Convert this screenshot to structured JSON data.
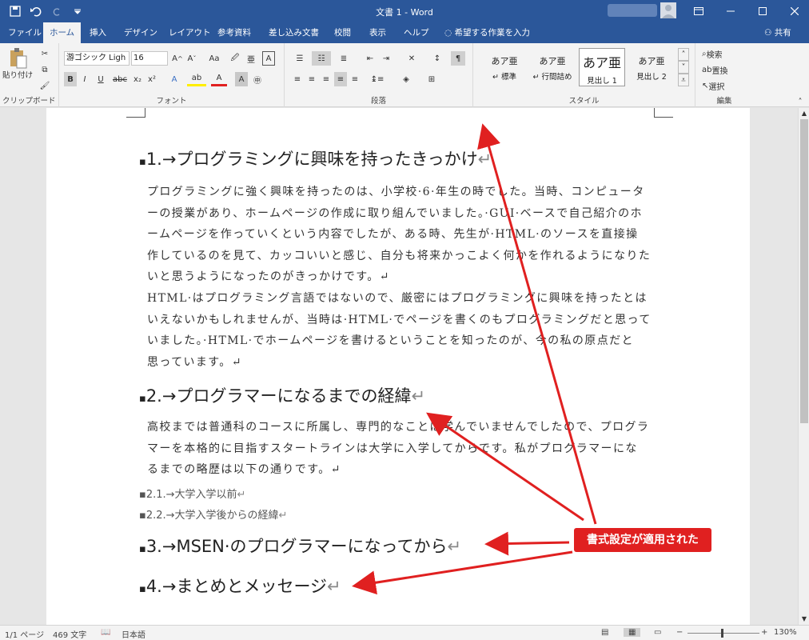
{
  "window": {
    "title": "文書 1 - Word",
    "share": "共有"
  },
  "tabs": [
    "ファイル",
    "ホーム",
    "挿入",
    "デザイン",
    "レイアウト",
    "参考資料",
    "差し込み文書",
    "校閲",
    "表示",
    "ヘルプ",
    "希望する作業を入力"
  ],
  "ribbon": {
    "clipboard": {
      "paste": "貼り付け",
      "label": "クリップボード"
    },
    "font": {
      "name": "游ゴシック Ligh",
      "size": "16",
      "label": "フォント",
      "case": "Aa"
    },
    "paragraph": {
      "label": "段落"
    },
    "styles": {
      "label": "スタイル",
      "items": [
        {
          "sample": "あア亜",
          "name": "↵ 標準"
        },
        {
          "sample": "あア亜",
          "name": "↵ 行間詰め"
        },
        {
          "sample": "あア亜",
          "name": "見出し 1"
        },
        {
          "sample": "あア亜",
          "name": "見出し 2"
        }
      ]
    },
    "editing": {
      "search": "検索",
      "replace": "置換",
      "select": "選択",
      "label": "編集"
    }
  },
  "document": {
    "heading1": "1.→プログラミングに興味を持ったきっかけ",
    "para1": [
      "プログラミングに強く興味を持ったのは、小学校·6·年生の時でした。当時、コンピュータ",
      "ーの授業があり、ホームページの作成に取り組んでいました。·GUI·ベースで自己紹介のホ",
      "ームページを作っていくという内容でしたが、ある時、先生が·HTML·のソースを直接操",
      "作しているのを見て、カッコいいと感じ、自分も将来かっこよく何かを作れるようになりた",
      "いと思うようになったのがきっかけです。↵"
    ],
    "para2": [
      "HTML·はプログラミング言語ではないので、厳密にはプログラミングに興味を持ったとは",
      "いえないかもしれませんが、当時は·HTML·でページを書くのもプログラミングだと思って",
      "いました。·HTML·でホームページを書けるということを知ったのが、今の私の原点だと",
      "思っています。↵"
    ],
    "heading2": "2.→プログラマーになるまでの経緯",
    "para3": [
      "高校までは普通科のコースに所属し、専門的なことは学んでいませんでしたので、プログラ",
      "マーを本格的に目指すスタートラインは大学に入学してからです。私がプログラマーにな",
      "るまでの略歴は以下の通りです。↵"
    ],
    "sub1": "2.1.→大学入学以前",
    "sub2": "2.2.→大学入学後からの経緯",
    "heading3": "3.→MSEN·のプログラマーになってから",
    "heading4": "4.→まとめとメッセージ",
    "return_mark": "↵"
  },
  "annotation": {
    "text": "書式設定が適用された",
    "color": "#e02020"
  },
  "status": {
    "page": "1/1 ページ",
    "words": "469 文字",
    "language": "日本語",
    "zoom": "130%"
  }
}
